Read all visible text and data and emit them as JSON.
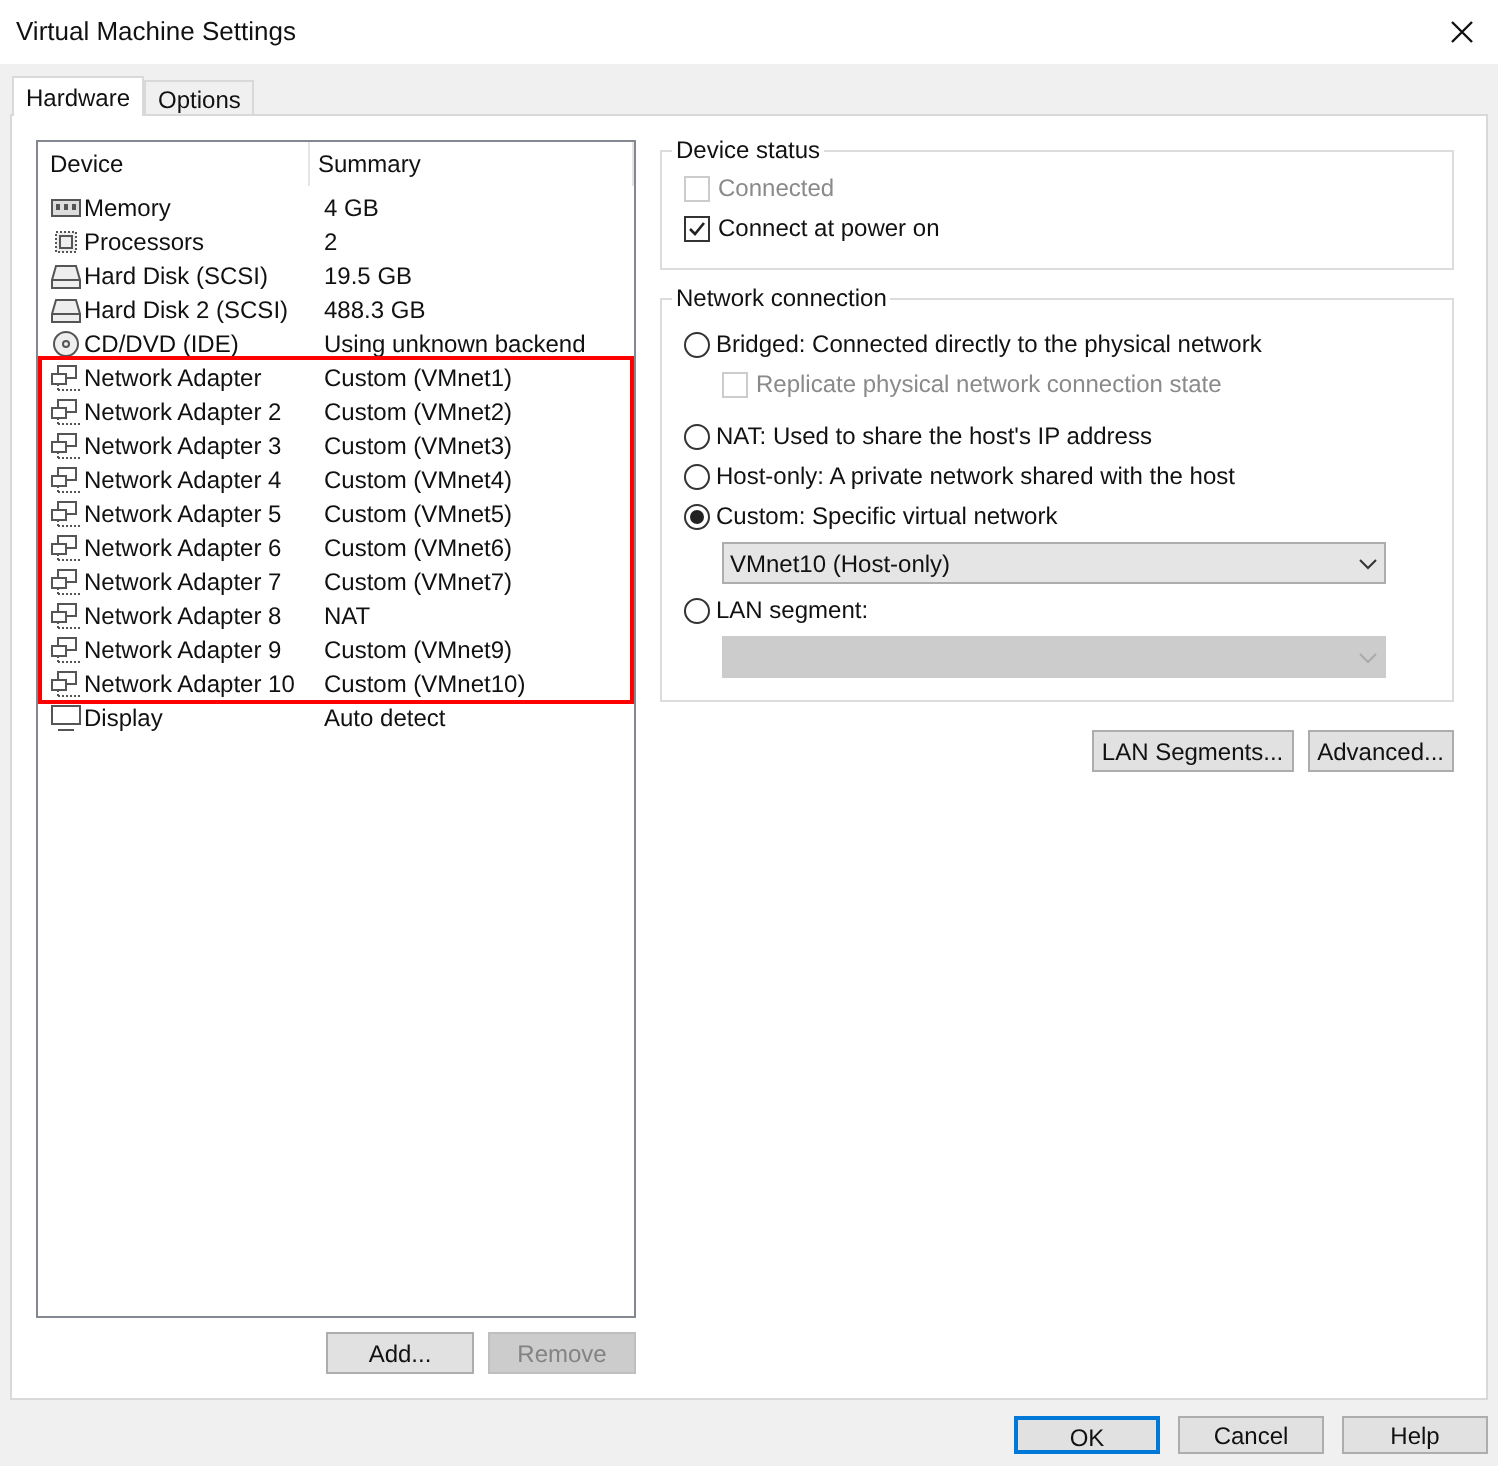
{
  "window": {
    "title": "Virtual Machine Settings"
  },
  "tabs": [
    {
      "label": "Hardware",
      "selected": true
    },
    {
      "label": "Options",
      "selected": false
    }
  ],
  "device_list": {
    "columns": [
      "Device",
      "Summary"
    ],
    "sections": [
      {
        "kind": "plain",
        "rows": [
          {
            "kind": "memory",
            "device": "Memory",
            "summary": "4 GB"
          },
          {
            "kind": "processor",
            "device": "Processors",
            "summary": "2"
          },
          {
            "kind": "disk",
            "device": "Hard Disk (SCSI)",
            "summary": "19.5 GB"
          },
          {
            "kind": "disk",
            "device": "Hard Disk 2 (SCSI)",
            "summary": "488.3 GB"
          },
          {
            "kind": "cd",
            "device": "CD/DVD (IDE)",
            "summary": "Using unknown backend"
          }
        ]
      },
      {
        "kind": "framed",
        "rows": [
          {
            "kind": "network",
            "device": "Network Adapter",
            "summary": "Custom (VMnet1)"
          },
          {
            "kind": "network",
            "device": "Network Adapter 2",
            "summary": "Custom (VMnet2)"
          },
          {
            "kind": "network",
            "device": "Network Adapter 3",
            "summary": "Custom (VMnet3)"
          },
          {
            "kind": "network",
            "device": "Network Adapter 4",
            "summary": "Custom (VMnet4)"
          },
          {
            "kind": "network",
            "device": "Network Adapter 5",
            "summary": "Custom (VMnet5)"
          },
          {
            "kind": "network",
            "device": "Network Adapter 6",
            "summary": "Custom (VMnet6)"
          },
          {
            "kind": "network",
            "device": "Network Adapter 7",
            "summary": "Custom (VMnet7)"
          },
          {
            "kind": "network",
            "device": "Network Adapter 8",
            "summary": "NAT"
          },
          {
            "kind": "network",
            "device": "Network Adapter 9",
            "summary": "Custom (VMnet9)"
          },
          {
            "kind": "network",
            "device": "Network Adapter 10",
            "summary": "Custom (VMnet10)"
          }
        ]
      },
      {
        "kind": "plain",
        "rows": [
          {
            "kind": "display",
            "device": "Display",
            "summary": "Auto detect"
          }
        ]
      }
    ]
  },
  "list_buttons": [
    {
      "label": "Add...",
      "disabled": false
    },
    {
      "label": "Remove",
      "disabled": true
    }
  ],
  "device_status": {
    "title": "Device status",
    "items": [
      {
        "label": "Connected",
        "checked": false,
        "disabled": true
      },
      {
        "label": "Connect at power on",
        "checked": true,
        "disabled": false
      }
    ]
  },
  "network_connection": {
    "title": "Network connection",
    "items": [
      {
        "kind": "radio",
        "label": "Bridged: Connected directly to the physical network",
        "selected": false
      },
      {
        "kind": "checkbox",
        "label": "Replicate physical network connection state",
        "checked": false,
        "disabled": true
      },
      {
        "kind": "radio",
        "label": "NAT: Used to share the host's IP address",
        "selected": false
      },
      {
        "kind": "radio",
        "label": "Host-only: A private network shared with the host",
        "selected": false
      },
      {
        "kind": "radio",
        "label": "Custom: Specific virtual network",
        "selected": true
      },
      {
        "kind": "dropdown",
        "value": "VMnet10 (Host-only)",
        "disabled": false
      },
      {
        "kind": "radio",
        "label": "LAN segment:",
        "selected": false
      },
      {
        "kind": "dropdown",
        "disabled": true
      }
    ]
  },
  "panel_buttons": [
    "LAN Segments...",
    "Advanced..."
  ],
  "dialog_buttons": [
    {
      "label": "OK",
      "default": true
    },
    {
      "label": "Cancel",
      "default": false
    },
    {
      "label": "Help",
      "default": false
    }
  ]
}
